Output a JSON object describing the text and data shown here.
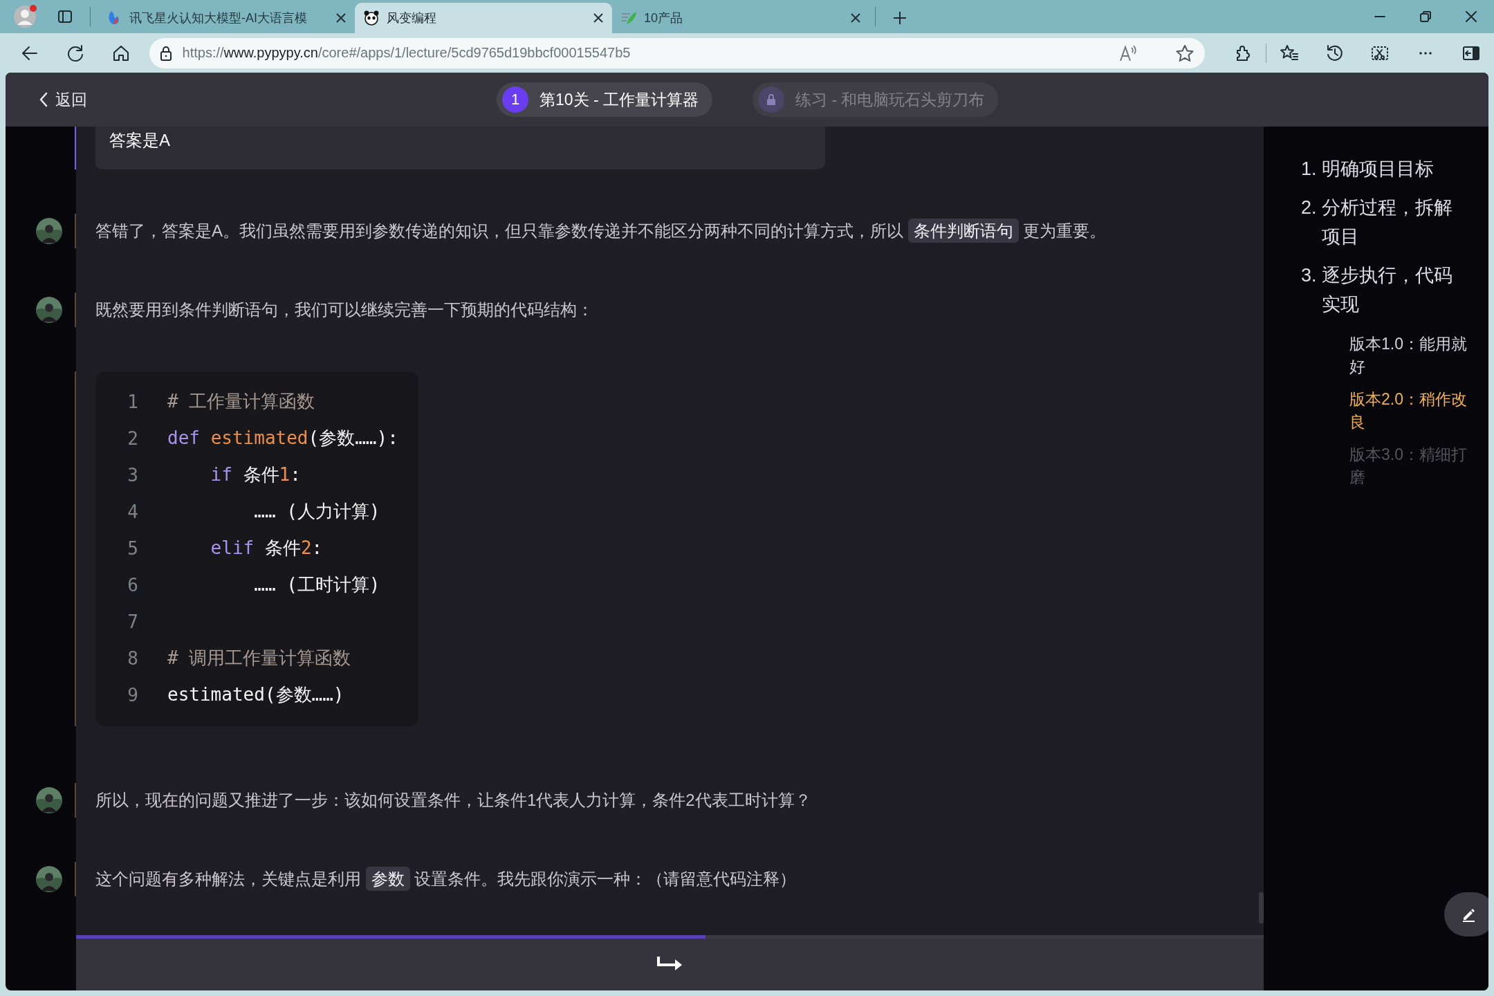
{
  "browser": {
    "tabs": [
      {
        "title": "讯飞星火认知大模型-AI大语言模",
        "kind": "flame",
        "selected": false
      },
      {
        "title": "风变编程",
        "kind": "panda",
        "selected": true
      },
      {
        "title": "10产品",
        "kind": "leaf",
        "selected": false
      }
    ],
    "url": {
      "scheme": "https://",
      "domain": "www.pypypy.cn",
      "path": "/core#/apps/1/lecture/5cd9765d19bbcf00015547b5"
    }
  },
  "header": {
    "back": "返回",
    "lessons": [
      {
        "kind": "current",
        "number": "1",
        "title": "第10关 - 工作量计算器",
        "selected": true
      },
      {
        "kind": "locked",
        "title": "练习 - 和电脑玩石头剪刀布",
        "selected": false
      }
    ]
  },
  "chat": [
    {
      "kind": "answer",
      "text": "答案是A"
    },
    {
      "kind": "message",
      "segments": [
        {
          "kind": "plain",
          "text": "答错了，答案是A。我们虽然需要用到参数传递的知识，但只靠参数传递并不能区分两种不同的计算方式，所以 "
        },
        {
          "kind": "chip",
          "text": "条件判断语句"
        },
        {
          "kind": "plain",
          "text": " 更为重要。"
        }
      ]
    },
    {
      "kind": "message",
      "segments": [
        {
          "kind": "plain",
          "text": "既然要用到条件判断语句，我们可以继续完善一下预期的代码结构："
        }
      ]
    },
    {
      "kind": "code",
      "lines": [
        {
          "number": "1",
          "tokens": [
            {
              "kind": "comment",
              "text": "# 工作量计算函数"
            }
          ]
        },
        {
          "number": "2",
          "tokens": [
            {
              "kind": "keyword",
              "text": "def "
            },
            {
              "kind": "function",
              "text": "estimated"
            },
            {
              "kind": "plain",
              "text": "(参数……):"
            }
          ]
        },
        {
          "number": "3",
          "tokens": [
            {
              "kind": "keyword",
              "text": "    if "
            },
            {
              "kind": "plain",
              "text": "条件"
            },
            {
              "kind": "number",
              "text": "1"
            },
            {
              "kind": "plain",
              "text": ":"
            }
          ]
        },
        {
          "number": "4",
          "tokens": [
            {
              "kind": "plain",
              "text": "        …… (人力计算)"
            }
          ]
        },
        {
          "number": "5",
          "tokens": [
            {
              "kind": "keyword",
              "text": "    elif "
            },
            {
              "kind": "plain",
              "text": "条件"
            },
            {
              "kind": "number",
              "text": "2"
            },
            {
              "kind": "plain",
              "text": ":"
            }
          ]
        },
        {
          "number": "6",
          "tokens": [
            {
              "kind": "plain",
              "text": "        …… (工时计算)"
            }
          ]
        },
        {
          "number": "7"
        },
        {
          "number": "8",
          "tokens": [
            {
              "kind": "comment",
              "text": "# 调用工作量计算函数"
            }
          ]
        },
        {
          "number": "9",
          "tokens": [
            {
              "kind": "plain",
              "text": "estimated(参数……)"
            }
          ]
        }
      ]
    },
    {
      "kind": "message",
      "segments": [
        {
          "kind": "plain",
          "text": "所以，现在的问题又推进了一步：该如何设置条件，让条件1代表人力计算，条件2代表工时计算？"
        }
      ]
    },
    {
      "kind": "message",
      "segments": [
        {
          "kind": "plain",
          "text": "这个问题有多种解法，关键点是利用 "
        },
        {
          "kind": "chip",
          "text": "参数"
        },
        {
          "kind": "plain",
          "text": " 设置条件。我先跟你演示一种：（请留意代码注释）"
        }
      ]
    }
  ],
  "progress": {
    "level": 0.53
  },
  "outline": [
    {
      "number": "1.",
      "title": "明确项目目标"
    },
    {
      "number": "2.",
      "title": "分析过程，拆解项目"
    },
    {
      "number": "3.",
      "title": "逐步执行，代码实现",
      "children": [
        {
          "title": "版本1.0：能用就好",
          "selected": false,
          "disabled": false
        },
        {
          "title": "版本2.0：稍作改良",
          "selected": true,
          "disabled": false
        },
        {
          "title": "版本3.0：精细打磨",
          "selected": false,
          "disabled": true
        }
      ]
    }
  ]
}
